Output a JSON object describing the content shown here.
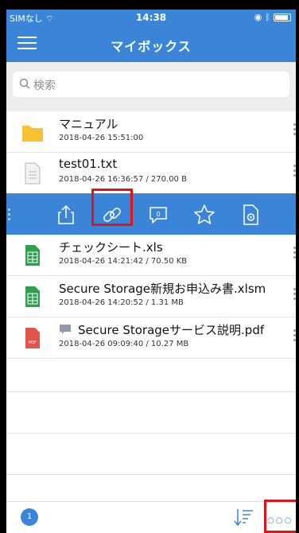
{
  "status": {
    "carrier": "SIMなし",
    "time": "14:38"
  },
  "header": {
    "title": "マイボックス"
  },
  "search": {
    "placeholder": "検索"
  },
  "files": [
    {
      "name": "マニュアル",
      "meta": "2018-04-26 15:51:00",
      "type": "folder"
    },
    {
      "name": "test01.txt",
      "meta": "2018-04-26 16:36:57 / 270.00 B",
      "type": "text"
    }
  ],
  "files_after": [
    {
      "name": "チェックシート.xls",
      "meta": "2018-04-26 14:21:42 / 70.50 KB",
      "type": "excel"
    },
    {
      "name": "Secure Storage新規お申込み書.xlsm",
      "meta": "2018-04-26 14:20:52 / 1.31 MB",
      "type": "excel"
    },
    {
      "name": "Secure Storageサービス説明.pdf",
      "meta": "2018-04-26 09:09:40 / 10.27 MB",
      "type": "pdf"
    }
  ],
  "action_bar": {
    "actions": [
      "share-icon",
      "link-icon",
      "comment-icon",
      "star-icon",
      "file-settings-icon"
    ]
  },
  "bottom": {
    "badge_count": "1"
  },
  "colors": {
    "accent": "#3a85d8",
    "highlight": "#e0141a",
    "folder": "#f7c232",
    "excel": "#2f9e4f",
    "pdf": "#e4534b"
  }
}
